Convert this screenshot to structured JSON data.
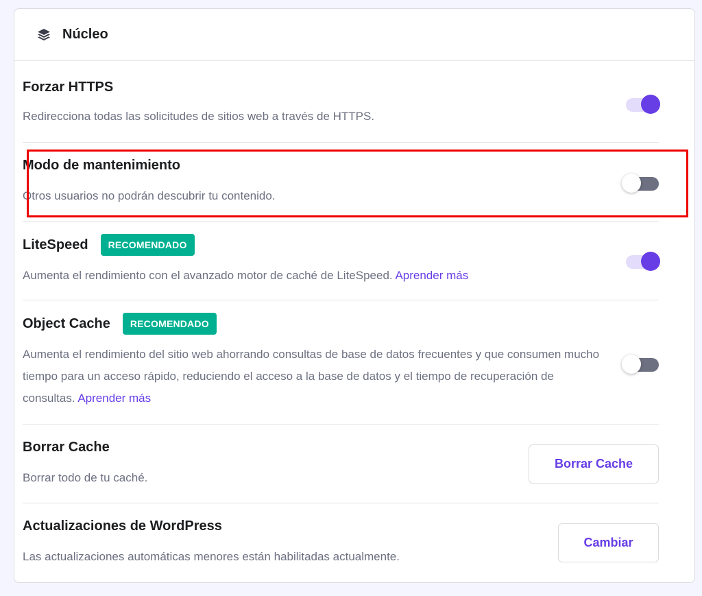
{
  "panel": {
    "title": "Núcleo",
    "header_icon": "layers-icon"
  },
  "settings": [
    {
      "id": "force-https",
      "title": "Forzar HTTPS",
      "description": "Redirecciona todas las solicitudes de sitios web a través de HTTPS.",
      "control": "toggle",
      "enabled": true
    },
    {
      "id": "maintenance-mode",
      "title": "Modo de mantenimiento",
      "description": "Otros usuarios no podrán descubrir tu contenido.",
      "control": "toggle",
      "enabled": false,
      "highlighted": true
    },
    {
      "id": "litespeed",
      "title": "LiteSpeed",
      "badge": "RECOMENDADO",
      "description": "Aumenta el rendimiento con el avanzado motor de caché de LiteSpeed.",
      "link": "Aprender más",
      "control": "toggle",
      "enabled": true
    },
    {
      "id": "object-cache",
      "title": "Object Cache",
      "badge": "RECOMENDADO",
      "description": "Aumenta el rendimiento del sitio web ahorrando consultas de base de datos frecuentes y que consumen mucho tiempo para un acceso rápido, reduciendo el acceso a la base de datos y el tiempo de recuperación de consultas.",
      "link": "Aprender más",
      "control": "toggle",
      "enabled": false
    },
    {
      "id": "clear-cache",
      "title": "Borrar Cache",
      "description": "Borrar todo de tu caché.",
      "control": "button",
      "button_label": "Borrar Cache"
    },
    {
      "id": "wordpress-updates",
      "title": "Actualizaciones de WordPress",
      "description": "Las actualizaciones automáticas menores están habilitadas actualmente.",
      "control": "button",
      "button_label": "Cambiar"
    }
  ],
  "colors": {
    "accent": "#673de6",
    "badge": "#00b090",
    "highlight_border": "#ee0000",
    "toggle_off": "#6d7081"
  }
}
